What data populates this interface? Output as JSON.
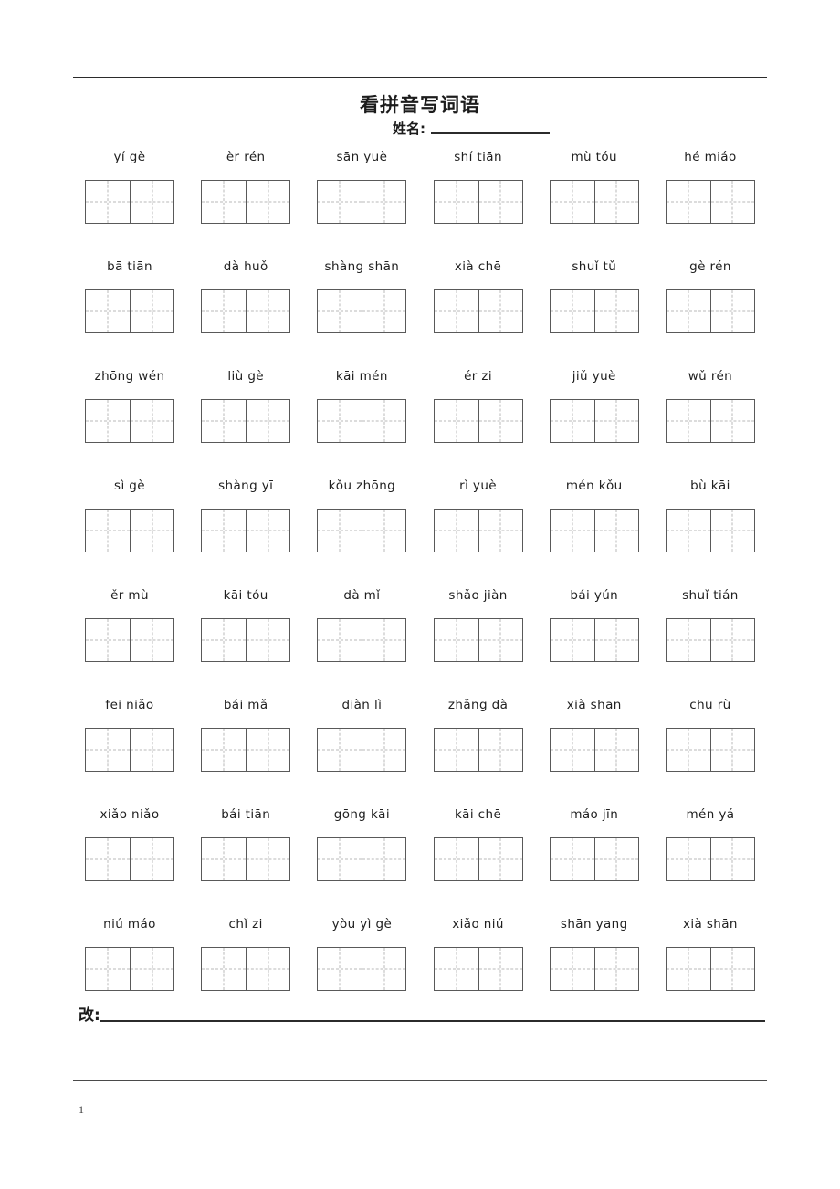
{
  "document": {
    "title": "看拼音写词语",
    "name_label": "姓名:",
    "correction_label": "改:",
    "page_number": "1"
  },
  "worksheet": {
    "rows": [
      {
        "items": [
          {
            "pinyin": "yí  gè",
            "syllables": [
              "yí",
              "gè"
            ]
          },
          {
            "pinyin": "èr  rén",
            "syllables": [
              "èr",
              "rén"
            ]
          },
          {
            "pinyin": "sān yuè",
            "syllables": [
              "sān",
              "yuè"
            ]
          },
          {
            "pinyin": "shí tiān",
            "syllables": [
              "shí",
              "tiān"
            ]
          },
          {
            "pinyin": "mù tóu",
            "syllables": [
              "mù",
              "tóu"
            ]
          },
          {
            "pinyin": "hé miáo",
            "syllables": [
              "hé",
              "miáo"
            ]
          }
        ]
      },
      {
        "items": [
          {
            "pinyin": "bā  tiān",
            "syllables": [
              "bā",
              "tiān"
            ]
          },
          {
            "pinyin": "dà  huǒ",
            "syllables": [
              "dà",
              "huǒ"
            ]
          },
          {
            "pinyin": "shàng shān",
            "syllables": [
              "shàng",
              "shān"
            ]
          },
          {
            "pinyin": "xià chē",
            "syllables": [
              "xià",
              "chē"
            ]
          },
          {
            "pinyin": "shuǐ  tǔ",
            "syllables": [
              "shuǐ",
              "tǔ"
            ]
          },
          {
            "pinyin": "gè  rén",
            "syllables": [
              "gè",
              "rén"
            ]
          }
        ]
      },
      {
        "items": [
          {
            "pinyin": "zhōng wén",
            "syllables": [
              "zhōng",
              "wén"
            ]
          },
          {
            "pinyin": "liù  gè",
            "syllables": [
              "liù",
              "gè"
            ]
          },
          {
            "pinyin": "kāi mén",
            "syllables": [
              "kāi",
              "mén"
            ]
          },
          {
            "pinyin": "ér  zi",
            "syllables": [
              "ér",
              "zi"
            ]
          },
          {
            "pinyin": "jiǔ  yuè",
            "syllables": [
              "jiǔ",
              "yuè"
            ]
          },
          {
            "pinyin": "wǔ  rén",
            "syllables": [
              "wǔ",
              "rén"
            ]
          }
        ]
      },
      {
        "items": [
          {
            "pinyin": "sì  gè",
            "syllables": [
              "sì",
              "gè"
            ]
          },
          {
            "pinyin": "shàng  yī",
            "syllables": [
              "shàng",
              "yī"
            ]
          },
          {
            "pinyin": "kǒu zhōng",
            "syllables": [
              "kǒu",
              "zhōng"
            ]
          },
          {
            "pinyin": "rì  yuè",
            "syllables": [
              "rì",
              "yuè"
            ]
          },
          {
            "pinyin": "mén kǒu",
            "syllables": [
              "mén",
              "kǒu"
            ]
          },
          {
            "pinyin": "bù  kāi",
            "syllables": [
              "bù",
              "kāi"
            ]
          }
        ]
      },
      {
        "items": [
          {
            "pinyin": "ěr  mù",
            "syllables": [
              "ěr",
              "mù"
            ]
          },
          {
            "pinyin": "kāi tóu",
            "syllables": [
              "kāi",
              "tóu"
            ]
          },
          {
            "pinyin": "dà  mǐ",
            "syllables": [
              "dà",
              "mǐ"
            ]
          },
          {
            "pinyin": "shǎo jiàn",
            "syllables": [
              "shǎo",
              "jiàn"
            ]
          },
          {
            "pinyin": "bái  yún",
            "syllables": [
              "bái",
              "yún"
            ]
          },
          {
            "pinyin": "shuǐ tián",
            "syllables": [
              "shuǐ",
              "tián"
            ]
          }
        ]
      },
      {
        "items": [
          {
            "pinyin": "fēi niǎo",
            "syllables": [
              "fēi",
              "niǎo"
            ]
          },
          {
            "pinyin": "bái  mǎ",
            "syllables": [
              "bái",
              "mǎ"
            ]
          },
          {
            "pinyin": "diàn lì",
            "syllables": [
              "diàn",
              "lì"
            ]
          },
          {
            "pinyin": "zhǎng dà",
            "syllables": [
              "zhǎng",
              "dà"
            ]
          },
          {
            "pinyin": "xià  shān",
            "syllables": [
              "xià",
              "shān"
            ]
          },
          {
            "pinyin": "chū rù",
            "syllables": [
              "chū",
              "rù"
            ]
          }
        ]
      },
      {
        "items": [
          {
            "pinyin": "xiǎo niǎo",
            "syllables": [
              "xiǎo",
              "niǎo"
            ]
          },
          {
            "pinyin": "bái  tiān",
            "syllables": [
              "bái",
              "tiān"
            ]
          },
          {
            "pinyin": "gōng kāi",
            "syllables": [
              "gōng",
              "kāi"
            ]
          },
          {
            "pinyin": "kāi chē",
            "syllables": [
              "kāi",
              "chē"
            ]
          },
          {
            "pinyin": "máo jīn",
            "syllables": [
              "máo",
              "jīn"
            ]
          },
          {
            "pinyin": "mén  yá",
            "syllables": [
              "mén",
              "yá"
            ]
          }
        ]
      },
      {
        "items": [
          {
            "pinyin": "niú máo",
            "syllables": [
              "niú",
              "máo"
            ]
          },
          {
            "pinyin": "chǐ zi",
            "syllables": [
              "chǐ",
              "zi"
            ]
          },
          {
            "pinyin": "yòu  yì gè",
            "syllables": [
              "yòu",
              "yì",
              "gè"
            ]
          },
          {
            "pinyin": "xiǎo niú",
            "syllables": [
              "xiǎo",
              "niú"
            ]
          },
          {
            "pinyin": "shān yang",
            "syllables": [
              "shān",
              "yang"
            ]
          },
          {
            "pinyin": "xià  shān",
            "syllables": [
              "xià",
              "shān"
            ]
          }
        ]
      }
    ]
  },
  "style": {
    "rule_color": "#2b2b2b",
    "box_border_color": "#595959",
    "guide_line_color": "#b9b9b9",
    "text_color": "#1c1c1c"
  }
}
